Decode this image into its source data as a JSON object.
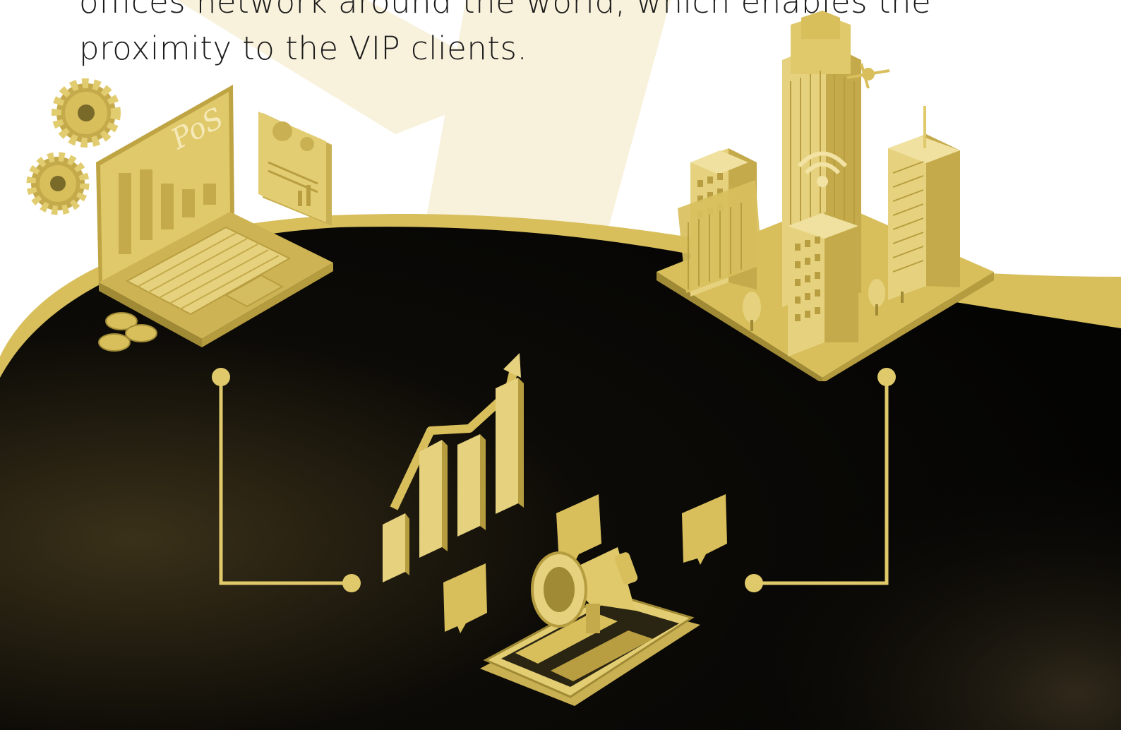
{
  "hero": {
    "line1": "offices network around the world, which enables the",
    "line2": "proximity to the VIP clients."
  },
  "illustrations": {
    "laptop_label": "PoS",
    "left": "laptop-pos-icon",
    "center": "growth-chart-megaphone-icon",
    "right": "city-buildings-icon"
  },
  "colors": {
    "gold": "#d8bf5c",
    "gold_light": "#ecdca0",
    "cream": "#f8f1dc",
    "dark": "#0a0906"
  }
}
